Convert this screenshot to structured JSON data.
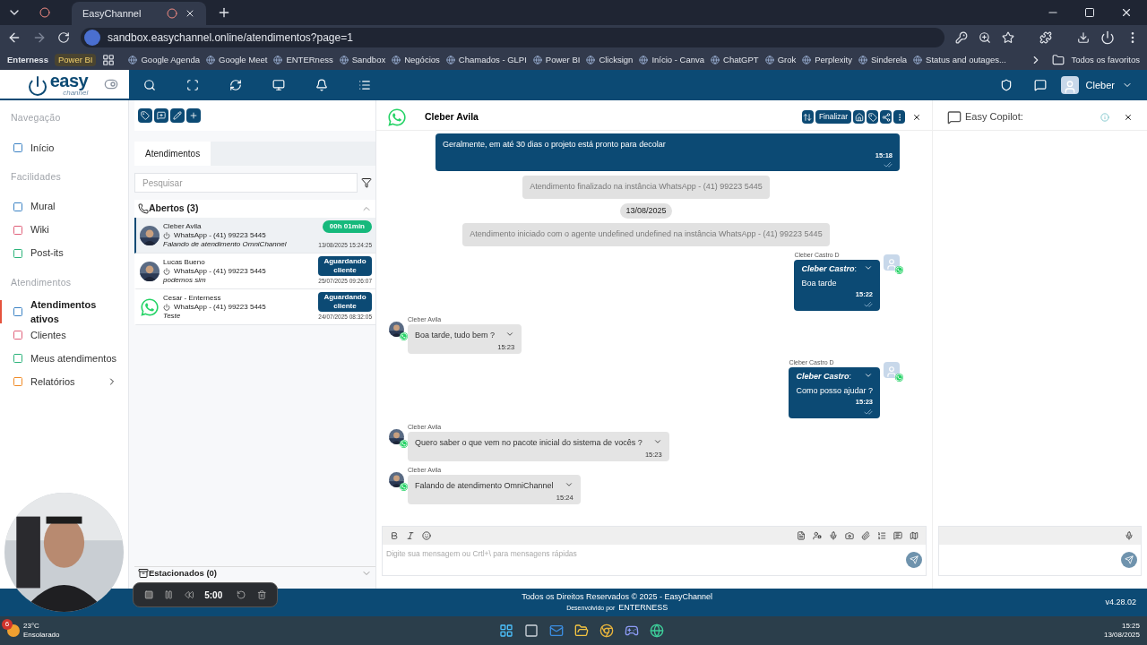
{
  "browser": {
    "tabs": [
      {
        "title": "EasyChannel",
        "selected": true
      }
    ],
    "url": "sandbox.easychannel.online/atendimentos?page=1",
    "bookmarks": [
      {
        "label": "Enterness",
        "kind": "plain"
      },
      {
        "label": "Power BI",
        "kind": "badge"
      },
      {
        "label": "Google Agenda",
        "kind": "favicon"
      },
      {
        "label": "Google Meet",
        "kind": "favicon"
      },
      {
        "label": "ENTERness",
        "kind": "favicon"
      },
      {
        "label": "Sandbox",
        "kind": "favicon"
      },
      {
        "label": "Negócios",
        "kind": "favicon"
      },
      {
        "label": "Chamados - GLPI",
        "kind": "favicon"
      },
      {
        "label": "Power BI",
        "kind": "favicon"
      },
      {
        "label": "Clicksign",
        "kind": "favicon"
      },
      {
        "label": "Início - Canva",
        "kind": "favicon"
      },
      {
        "label": "ChatGPT",
        "kind": "favicon"
      },
      {
        "label": "Grok",
        "kind": "favicon"
      },
      {
        "label": "Perplexity",
        "kind": "favicon"
      },
      {
        "label": "Sinderela",
        "kind": "favicon"
      },
      {
        "label": "Status and outages...",
        "kind": "favicon"
      }
    ],
    "all_bookmarks": "Todos os favoritos"
  },
  "app": {
    "logo": "easy",
    "logo_sub": "channel",
    "user": "Cleber"
  },
  "sidebar": [
    {
      "title": "Navegação",
      "items": [
        {
          "label": "Início",
          "color": "#3b82c4",
          "selected": false,
          "submenu": false
        }
      ]
    },
    {
      "title": "Facilidades",
      "items": [
        {
          "label": "Mural",
          "color": "#3b82c4",
          "selected": false,
          "submenu": false
        },
        {
          "label": "Wiki",
          "color": "#e0607a",
          "selected": false,
          "submenu": false
        },
        {
          "label": "Post-its",
          "color": "#2bb37a",
          "selected": false,
          "submenu": false
        }
      ]
    },
    {
      "title": "Atendimentos",
      "items": [
        {
          "label": "Atendimentos ativos",
          "color": "#3b82c4",
          "selected": true,
          "submenu": false
        },
        {
          "label": "Clientes",
          "color": "#e0607a",
          "selected": false,
          "submenu": false
        },
        {
          "label": "Meus atendimentos",
          "color": "#2bb37a",
          "selected": false,
          "submenu": false
        },
        {
          "label": "Relatórios",
          "color": "#f08a24",
          "selected": false,
          "submenu": true
        }
      ]
    }
  ],
  "list": {
    "tabs": [
      {
        "label": "Atendimentos",
        "selected": true
      }
    ],
    "search": {
      "placeholder": "Pesquisar"
    },
    "group": {
      "title": "Abertos (3)",
      "expanded": true
    },
    "conversations": [
      {
        "name": "Cleber Avila",
        "channel": "WhatsApp - (41) 99223 5445",
        "last": "Falando de atendimento OmniChannel",
        "status": {
          "kind": "timer",
          "text": "00h 01min"
        },
        "time": "13/08/2025 15:24:25",
        "selected": true
      },
      {
        "name": "Lucas Bueno",
        "channel": "WhatsApp - (41) 99223 5445",
        "last": "podemos sim",
        "status": {
          "kind": "waiting",
          "text": "Aguardando cliente"
        },
        "time": "25/07/2025 09:26:07",
        "selected": false
      },
      {
        "name": "Cesar - Enterness",
        "channel": "WhatsApp - (41) 99223 5445",
        "last": "Teste",
        "status": {
          "kind": "waiting",
          "text": "Aguardando cliente"
        },
        "time": "24/07/2025 08:32:05",
        "avatar": {
          "kind": "whatsapp"
        },
        "selected": false
      }
    ],
    "parked": {
      "title": "Estacionados (0)",
      "expanded": false
    }
  },
  "chat": {
    "contact": "Cleber Avila",
    "finish": "Finalizar",
    "messages": [
      {
        "kind": "outgoing",
        "text": "Geralmente, em até 30 dias o projeto está pronto para decolar",
        "time": "15:18"
      },
      {
        "kind": "system",
        "text": "Atendimento finalizado  na instância WhatsApp -  (41) 99223 5445"
      },
      {
        "kind": "date",
        "text": "13/08/2025"
      },
      {
        "kind": "system",
        "text": "Atendimento iniciado com o agente undefined undefined  na instância WhatsApp -  (41) 99223 5445"
      },
      {
        "kind": "outgoing",
        "sender": "Cleber Castro D",
        "author": "Cleber Castro",
        "author_suffix": ":",
        "text": "Boa tarde",
        "time": "15:22"
      },
      {
        "kind": "incoming",
        "sender": "Cleber Avila",
        "text": "Boa tarde, tudo bem ?",
        "time": "15:23"
      },
      {
        "kind": "outgoing",
        "sender": "Cleber Castro D",
        "author": "Cleber Castro",
        "author_suffix": ":",
        "text": "Como posso ajudar ?",
        "time": "15:23"
      },
      {
        "kind": "incoming",
        "sender": "Cleber Avila",
        "text": "Quero saber o que vem no pacote inicial do sistema de vocês ?",
        "time": "15:23"
      },
      {
        "kind": "incoming",
        "sender": "Cleber Avila",
        "text": "Falando de atendimento OmniChannel",
        "time": "15:24"
      }
    ],
    "composer": {
      "placeholder": "Digite sua mensagem ou Crtl+\\ para mensagens rápidas"
    }
  },
  "copilot": {
    "title": "Easy Copilot:"
  },
  "footer": {
    "rights": "Todos os Direitos Reservados © 2025 - EasyChannel",
    "dev": "Desenvolvido por",
    "dev_name": "ENTERNESS",
    "version": "v4.28.02"
  },
  "recorder": {
    "time": "5:00"
  },
  "taskbar": {
    "temp": "23°C",
    "weather": "Ensolarado",
    "badge": "6",
    "time": "15:25",
    "date": "13/08/2025"
  }
}
